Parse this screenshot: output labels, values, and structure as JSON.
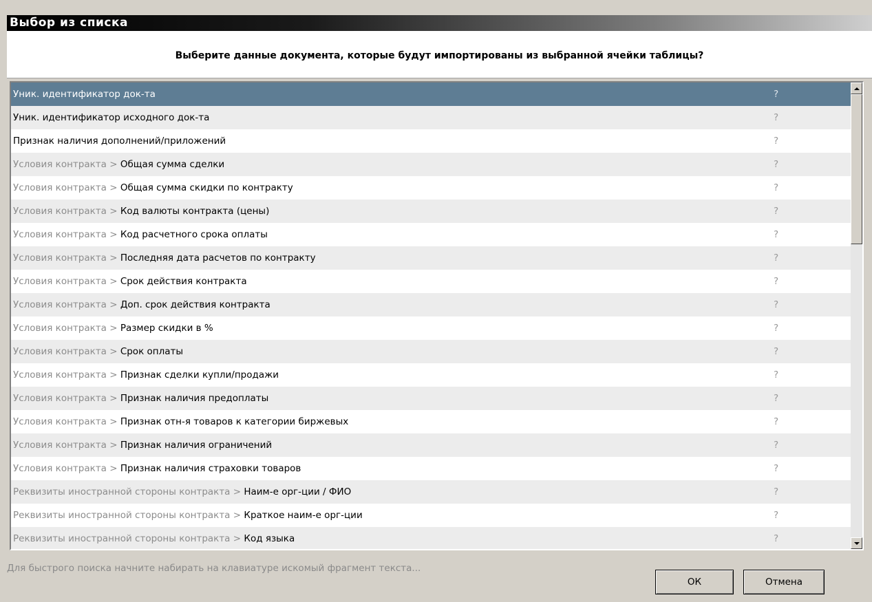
{
  "window": {
    "title": "Выбор из списка"
  },
  "prompt": "Выберите данные документа, которые будут импортированы из выбранной ячейки таблицы?",
  "list": {
    "rows": [
      {
        "prefix": "",
        "label": "Уник. идентификатор док-та",
        "marker": "?",
        "selected": true
      },
      {
        "prefix": "",
        "label": "Уник. идентификатор исходного док-та",
        "marker": "?"
      },
      {
        "prefix": "",
        "label": "Признак наличия дополнений/приложений",
        "marker": "?"
      },
      {
        "prefix": "Условия контракта > ",
        "label": "Общая сумма сделки",
        "marker": "?"
      },
      {
        "prefix": "Условия контракта > ",
        "label": "Общая сумма скидки по контракту",
        "marker": "?"
      },
      {
        "prefix": "Условия контракта > ",
        "label": "Код валюты контракта (цены)",
        "marker": "?"
      },
      {
        "prefix": "Условия контракта > ",
        "label": "Код расчетного срока оплаты",
        "marker": "?"
      },
      {
        "prefix": "Условия контракта > ",
        "label": "Последняя дата расчетов по контракту",
        "marker": "?"
      },
      {
        "prefix": "Условия контракта > ",
        "label": "Срок действия контракта",
        "marker": "?"
      },
      {
        "prefix": "Условия контракта > ",
        "label": "Доп. срок действия контракта",
        "marker": "?"
      },
      {
        "prefix": "Условия контракта > ",
        "label": "Размер скидки в %",
        "marker": "?"
      },
      {
        "prefix": "Условия контракта > ",
        "label": "Срок оплаты",
        "marker": "?"
      },
      {
        "prefix": "Условия контракта > ",
        "label": "Признак сделки купли/продажи",
        "marker": "?"
      },
      {
        "prefix": "Условия контракта > ",
        "label": "Признак наличия предоплаты",
        "marker": "?"
      },
      {
        "prefix": "Условия контракта > ",
        "label": "Признак отн-я товаров к категории биржевых",
        "marker": "?"
      },
      {
        "prefix": "Условия контракта > ",
        "label": "Признак наличия ограничений",
        "marker": "?"
      },
      {
        "prefix": "Условия контракта > ",
        "label": "Признак наличия страховки товаров",
        "marker": "?"
      },
      {
        "prefix": "Реквизиты иностранной стороны контракта > ",
        "label": "Наим-е орг-ции / ФИО",
        "marker": "?"
      },
      {
        "prefix": "Реквизиты иностранной стороны контракта > ",
        "label": "Краткое наим-е орг-ции",
        "marker": "?"
      },
      {
        "prefix": "Реквизиты иностранной стороны контракта > ",
        "label": "Код языка",
        "marker": "?"
      },
      {
        "prefix": "",
        "label": "",
        "marker": "",
        "partial": true
      }
    ]
  },
  "hint": "Для быстрого поиска начните набирать на клавиатуре  искомый фрагмент текста...",
  "buttons": {
    "ok": "ОК",
    "cancel": "Отмена"
  },
  "colors": {
    "selection": "#5e7d94",
    "alt_row": "#ececec"
  },
  "icons": {
    "scroll_up": "scroll-up-arrow-icon",
    "scroll_down": "scroll-down-arrow-icon"
  }
}
